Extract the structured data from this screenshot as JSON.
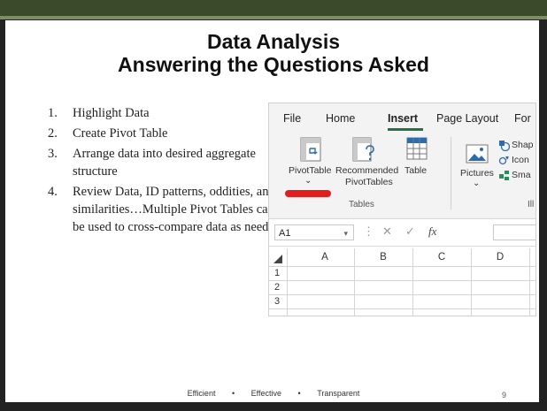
{
  "slide": {
    "title_line1": "Data Analysis",
    "title_line2": "Answering the Questions Asked",
    "steps": [
      {
        "num": "1.",
        "text": "Highlight Data"
      },
      {
        "num": "2.",
        "text": "Create Pivot Table"
      },
      {
        "num": "3.",
        "text": "Arrange data into desired aggregate structure"
      },
      {
        "num": "4.",
        "text": "Review Data, ID patterns, oddities, and similarities…Multiple Pivot Tables can be used to cross-compare data as needed"
      }
    ],
    "footer": {
      "items": [
        "Efficient",
        "•",
        "Effective",
        "•",
        "Transparent"
      ],
      "page_number": "9"
    }
  },
  "excel": {
    "tabs": [
      "File",
      "Home",
      "Insert",
      "Page Layout",
      "For"
    ],
    "active_tab": "Insert",
    "ribbon": {
      "pivottable": "PivotTable",
      "pivottable_dropdown": "⌄",
      "recommended_line1": "Recommended",
      "recommended_line2": "PivotTables",
      "table": "Table",
      "tables_group": "Tables",
      "pictures": "Pictures",
      "pictures_dropdown": "⌄",
      "shapes": "Shap",
      "icons": "Icon",
      "smartart": "Sma",
      "group_right": "Ill"
    },
    "formula_bar": {
      "name_box": "A1",
      "dropdown": "▾",
      "sep": "⋮",
      "cancel": "✕",
      "enter": "✓",
      "fx": "fx"
    },
    "columns": [
      "A",
      "B",
      "C",
      "D"
    ],
    "rows": [
      "1",
      "2",
      "3"
    ],
    "accent_color": "#217346",
    "highlight_color": "#e01e1e"
  }
}
